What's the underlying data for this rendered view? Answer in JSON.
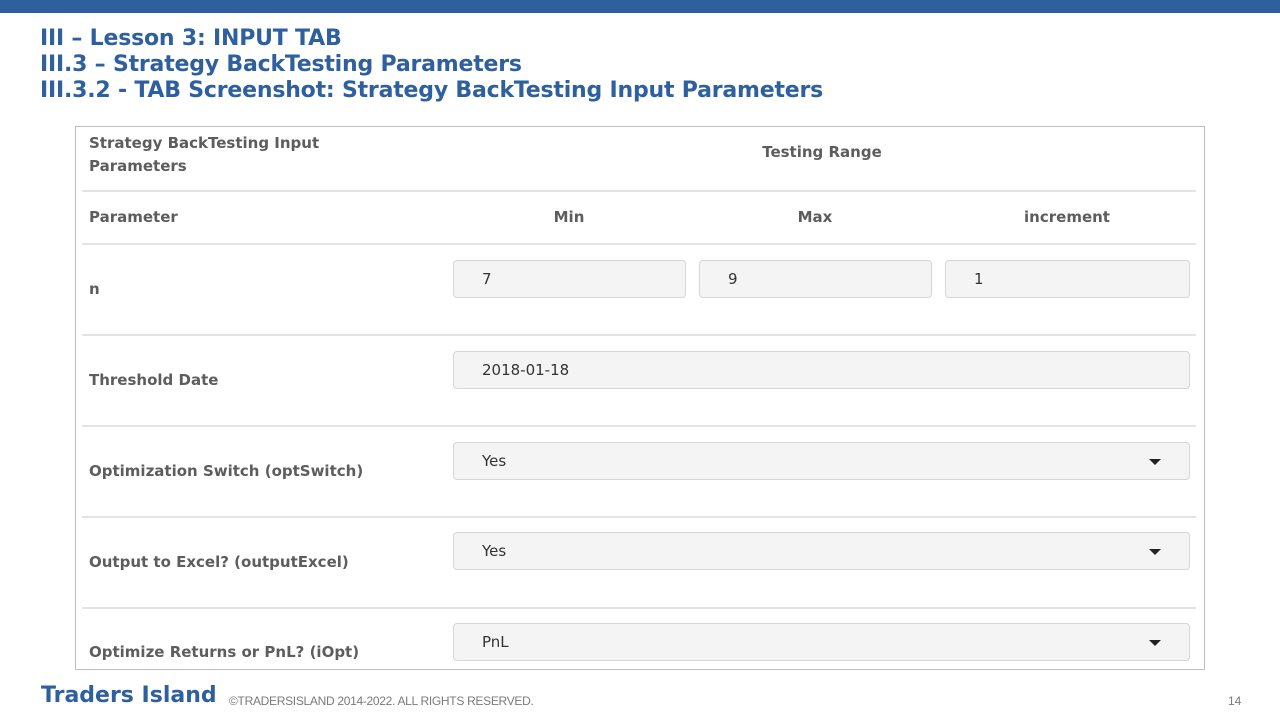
{
  "slide": {
    "title_line1": "III – Lesson 3: INPUT TAB",
    "title_line2": "III.3 – Strategy BackTesting Parameters",
    "title_line3": "III.3.2 - TAB Screenshot: Strategy BackTesting Input Parameters",
    "footer_brand": "Traders Island",
    "footer_copyright": "©TRADERSISLAND 2014-2022. ALL RIGHTS RESERVED.",
    "page_number": "14",
    "accent_color": "#2e5f9e"
  },
  "panel": {
    "header_left": "Strategy BackTesting Input Parameters",
    "header_right": "Testing Range",
    "columns": {
      "parameter": "Parameter",
      "min": "Min",
      "max": "Max",
      "increment": "increment"
    },
    "n_row": {
      "label": "n",
      "min": "7",
      "max": "9",
      "increment": "1"
    },
    "threshold_row": {
      "label": "Threshold Date",
      "value": "2018-01-18"
    },
    "opt_switch_row": {
      "label": "Optimization Switch (optSwitch)",
      "value": "Yes",
      "icon": "chevron-down-icon"
    },
    "output_excel_row": {
      "label": "Output to Excel? (outputExcel)",
      "value": "Yes",
      "icon": "chevron-down-icon"
    },
    "iopt_row": {
      "label": "Optimize Returns or PnL? (iOpt)",
      "value": "PnL",
      "icon": "chevron-down-icon"
    }
  }
}
